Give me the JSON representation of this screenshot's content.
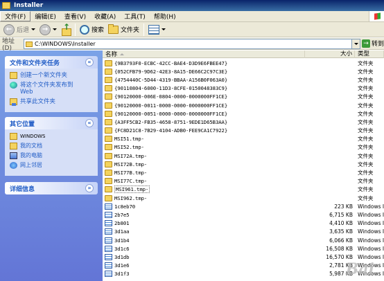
{
  "window": {
    "title": "Installer"
  },
  "menu": [
    "文件(F)",
    "编辑(E)",
    "查看(V)",
    "收藏(A)",
    "工具(T)",
    "帮助(H)"
  ],
  "toolbar": {
    "back_label": "后退",
    "search_label": "搜索",
    "folders_label": "文件夹"
  },
  "address": {
    "label": "地址(D)",
    "path": "C:\\WINDOWS\\Installer",
    "go_label": "转到"
  },
  "tasks": {
    "title": "文件和文件夹任务",
    "items": [
      "创建一个新文件夹",
      "将这个文件夹发布到",
      "Web",
      "共享此文件夹"
    ]
  },
  "places": {
    "title": "其它位置",
    "items": [
      "WINDOWS",
      "我的文档",
      "我的电脑",
      "网上邻居"
    ]
  },
  "details": {
    "title": "详细信息"
  },
  "columns": {
    "name": "名称",
    "size": "大小",
    "type": "类型"
  },
  "rows": [
    {
      "name": "{9B3793F0-ECBC-42CC-BAE4-D3D9E6FBEE47}",
      "size": "",
      "type": "文件夹",
      "kind": "folder"
    },
    {
      "name": "{052CFB79-9D62-42E3-8A15-DE66C2C97C3E}",
      "size": "",
      "type": "文件夹",
      "kind": "folder"
    },
    {
      "name": "{4754440C-5D44-4319-BBAA-A156B0F063A0}",
      "size": "",
      "type": "文件夹",
      "kind": "folder"
    },
    {
      "name": "{90110804-6000-11D3-8CFE-0150048383C9}",
      "size": "",
      "type": "文件夹",
      "kind": "folder"
    },
    {
      "name": "{90120000-006E-0804-0000-0000000FF1CE}",
      "size": "",
      "type": "文件夹",
      "kind": "folder"
    },
    {
      "name": "{90120000-0011-0000-0000-0000000FF1CE}",
      "size": "",
      "type": "文件夹",
      "kind": "folder"
    },
    {
      "name": "{90120000-0051-0000-0000-0000000FF1CE}",
      "size": "",
      "type": "文件夹",
      "kind": "folder"
    },
    {
      "name": "{A3FF5CB2-FB35-4658-8751-9EDE1D65B3AA}",
      "size": "",
      "type": "文件夹",
      "kind": "folder"
    },
    {
      "name": "{FC8D21C8-7B29-4104-ADB0-FEE9CA1C7922}",
      "size": "",
      "type": "文件夹",
      "kind": "folder"
    },
    {
      "name": "MSI51.tmp-",
      "size": "",
      "type": "文件夹",
      "kind": "folder"
    },
    {
      "name": "MSI52.tmp-",
      "size": "",
      "type": "文件夹",
      "kind": "folder"
    },
    {
      "name": "MSI72A.tmp-",
      "size": "",
      "type": "文件夹",
      "kind": "folder"
    },
    {
      "name": "MSI72B.tmp-",
      "size": "",
      "type": "文件夹",
      "kind": "folder"
    },
    {
      "name": "MSI77B.tmp-",
      "size": "",
      "type": "文件夹",
      "kind": "folder"
    },
    {
      "name": "MSI77C.tmp-",
      "size": "",
      "type": "文件夹",
      "kind": "folder"
    },
    {
      "name": "MSI961.tmp-",
      "size": "",
      "type": "文件夹",
      "kind": "folder",
      "focused": true
    },
    {
      "name": "MSI962.tmp-",
      "size": "",
      "type": "文件夹",
      "kind": "folder"
    },
    {
      "name": "1c8eb70",
      "size": "223 KB",
      "type": "Windows I",
      "kind": "file"
    },
    {
      "name": "2b7e5",
      "size": "6,715 KB",
      "type": "Windows I",
      "kind": "file"
    },
    {
      "name": "2b801",
      "size": "4,410 KB",
      "type": "Windows I",
      "kind": "file"
    },
    {
      "name": "3d1aa",
      "size": "3,635 KB",
      "type": "Windows I",
      "kind": "file"
    },
    {
      "name": "3d1b4",
      "size": "6,066 KB",
      "type": "Windows I",
      "kind": "file"
    },
    {
      "name": "3d1c6",
      "size": "16,508 KB",
      "type": "Windows I",
      "kind": "file"
    },
    {
      "name": "3d1db",
      "size": "16,570 KB",
      "type": "Windows I",
      "kind": "file"
    },
    {
      "name": "3d1e6",
      "size": "2,781 KB",
      "type": "Windows I",
      "kind": "file"
    },
    {
      "name": "3d1f3",
      "size": "5,987 KB",
      "type": "Windows I",
      "kind": "file"
    }
  ],
  "watermark": "Bai"
}
